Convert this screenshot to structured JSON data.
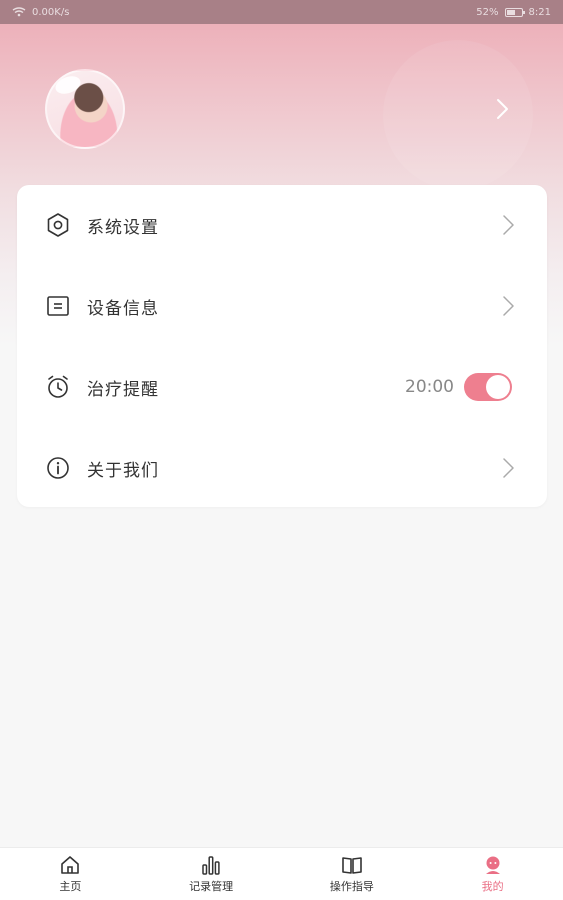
{
  "status_bar": {
    "network_speed": "0.00K/s",
    "battery": "52%",
    "time": "8:21"
  },
  "profile": {
    "avatar_icon": "user-avatar",
    "arrow_icon": "chevron-right-icon"
  },
  "menu": {
    "items": [
      {
        "label": "系统设置",
        "icon": "gear-hex-icon"
      },
      {
        "label": "设备信息",
        "icon": "info-card-icon"
      },
      {
        "label": "治疗提醒",
        "icon": "alarm-clock-icon",
        "time": "20:00",
        "toggle_on": true
      },
      {
        "label": "关于我们",
        "icon": "info-circle-icon"
      }
    ]
  },
  "tabbar": {
    "tabs": [
      {
        "label": "主页",
        "icon": "home-icon"
      },
      {
        "label": "记录管理",
        "icon": "bar-chart-icon"
      },
      {
        "label": "操作指导",
        "icon": "book-icon"
      },
      {
        "label": "我的",
        "icon": "profile-icon",
        "active": true
      }
    ],
    "active_color": "#ea6f85"
  },
  "colors": {
    "accent": "#ee7f8f",
    "header_top": "#ecaab4"
  }
}
